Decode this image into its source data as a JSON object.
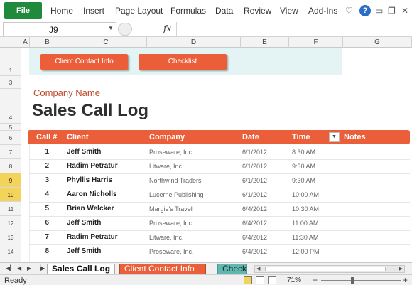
{
  "ribbon": {
    "file_label": "File",
    "tabs": [
      "Home",
      "Insert",
      "Page Layout",
      "Formulas",
      "Data",
      "Review",
      "View",
      "Add-Ins"
    ],
    "icons": [
      "heart-icon",
      "help-icon",
      "minimize-ribbon-icon",
      "restore-icon",
      "close-icon"
    ],
    "help_glyph": "?"
  },
  "formula_bar": {
    "cell_ref": "J9",
    "fx": "fx",
    "value": ""
  },
  "columns": [
    "A",
    "B",
    "C",
    "D",
    "E",
    "F",
    "G"
  ],
  "rows": [
    "1",
    "3",
    "4",
    "5",
    "6",
    "7",
    "8",
    "9",
    "10",
    "11",
    "12",
    "13",
    "14"
  ],
  "sheet": {
    "nav_buttons": [
      "Client Contact Info",
      "Checklist"
    ],
    "company_label": "Company Name",
    "title": "Sales Call Log",
    "headers": [
      "Call #",
      "Client",
      "Company",
      "Date",
      "Time",
      "Notes"
    ],
    "records": [
      {
        "call": "1",
        "client": "Jeff Smith",
        "company": "Proseware, Inc.",
        "date": "6/1/2012",
        "time": "8:30 AM"
      },
      {
        "call": "2",
        "client": "Radim Petratur",
        "company": "Litware, Inc.",
        "date": "6/1/2012",
        "time": "9:30 AM"
      },
      {
        "call": "3",
        "client": "Phyllis Harris",
        "company": "Northwind Traders",
        "date": "6/1/2012",
        "time": "9:30 AM"
      },
      {
        "call": "4",
        "client": "Aaron Nicholls",
        "company": "Lucerne Publishing",
        "date": "6/1/2012",
        "time": "10:00 AM"
      },
      {
        "call": "5",
        "client": "Brian Welcker",
        "company": "Margie's Travel",
        "date": "6/4/2012",
        "time": "10:30 AM"
      },
      {
        "call": "6",
        "client": "Jeff Smith",
        "company": "Proseware, Inc.",
        "date": "6/4/2012",
        "time": "11:00 AM"
      },
      {
        "call": "7",
        "client": "Radim Petratur",
        "company": "Litware, Inc.",
        "date": "6/4/2012",
        "time": "11:30 AM"
      },
      {
        "call": "8",
        "client": "Jeff Smith",
        "company": "Proseware, Inc.",
        "date": "6/4/2012",
        "time": "12:00 PM"
      }
    ]
  },
  "sheet_tabs": [
    "Sales Call Log",
    "Client Contact Info",
    "Checkl"
  ],
  "status": {
    "ready": "Ready",
    "zoom": "71%"
  },
  "colors": {
    "accent": "#ea5f3a",
    "file_tab": "#1f8a3b",
    "nav_band": "#e4f3f4",
    "selected_row_header": "#f4d35b"
  }
}
